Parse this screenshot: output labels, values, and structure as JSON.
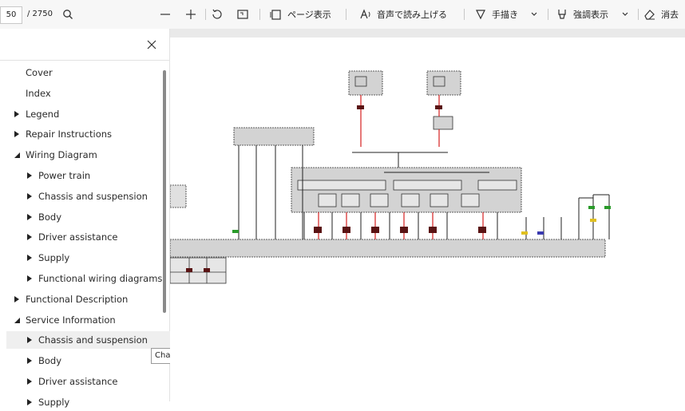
{
  "toolbar": {
    "page_number": "50",
    "page_total": "/ 2750",
    "page_view_label": "ページ表示",
    "read_aloud_label": "音声で読み上げる",
    "draw_label": "手描き",
    "highlight_label": "強調表示",
    "erase_label": "消去"
  },
  "sidebar": {
    "items": [
      {
        "label": "Cover",
        "level": 0,
        "expander": "none"
      },
      {
        "label": "Index",
        "level": 0,
        "expander": "none"
      },
      {
        "label": "Legend",
        "level": 0,
        "expander": "collapsed"
      },
      {
        "label": "Repair Instructions",
        "level": 0,
        "expander": "collapsed"
      },
      {
        "label": "Wiring Diagram",
        "level": 0,
        "expander": "expanded"
      },
      {
        "label": "Power train",
        "level": 1,
        "expander": "collapsed"
      },
      {
        "label": "Chassis and suspension",
        "level": 1,
        "expander": "collapsed"
      },
      {
        "label": "Body",
        "level": 1,
        "expander": "collapsed"
      },
      {
        "label": "Driver assistance",
        "level": 1,
        "expander": "collapsed"
      },
      {
        "label": "Supply",
        "level": 1,
        "expander": "collapsed"
      },
      {
        "label": "Functional wiring diagrams",
        "level": 1,
        "expander": "collapsed"
      },
      {
        "label": "Functional Description",
        "level": 0,
        "expander": "collapsed"
      },
      {
        "label": "Service Information",
        "level": 0,
        "expander": "expanded"
      },
      {
        "label": "Chassis and suspension",
        "level": 1,
        "expander": "collapsed",
        "selected": true
      },
      {
        "label": "Body",
        "level": 1,
        "expander": "collapsed"
      },
      {
        "label": "Driver assistance",
        "level": 1,
        "expander": "collapsed"
      },
      {
        "label": "Supply",
        "level": 1,
        "expander": "collapsed"
      }
    ],
    "tooltip": "Chassis and suspension"
  },
  "colors": {
    "wire_red": "#d62020",
    "module_fill": "#d3d3d3",
    "connector_dark": "#5a1414"
  }
}
